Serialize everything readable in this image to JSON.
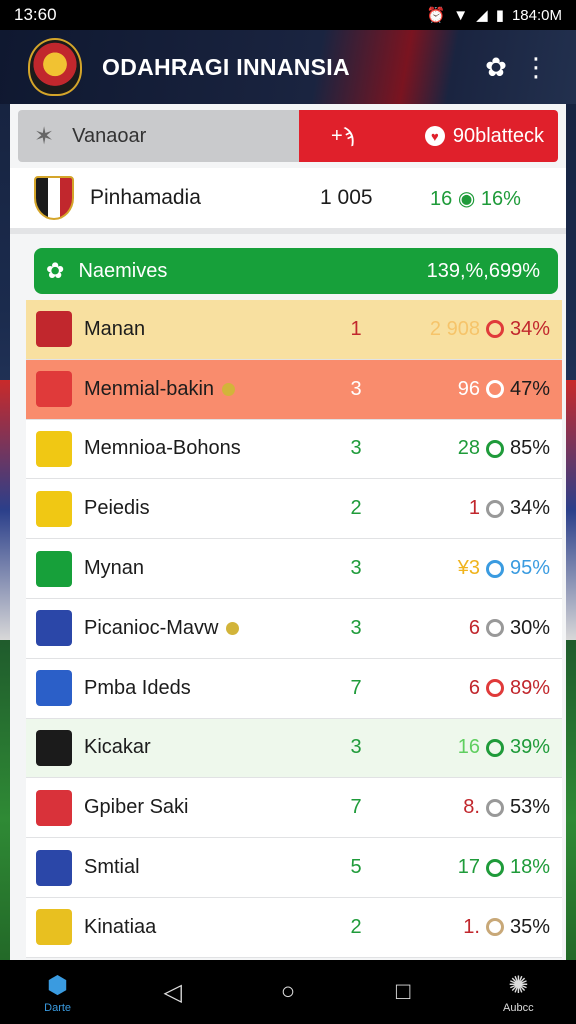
{
  "status_bar": {
    "time": "13:60",
    "right_time": "184:0M"
  },
  "header": {
    "title": "ODAHRAGI INNANSIA"
  },
  "tabs": {
    "left_label": "Vanaoar",
    "right_prefix": "+ϡ",
    "right_label": "90blatteck"
  },
  "leader": {
    "name": "Pinhamadia",
    "score": "1 005",
    "stat_num": "16",
    "stat_pct": "16%"
  },
  "banner": {
    "label": "Naemives",
    "value": "139,%,699%"
  },
  "rows": [
    {
      "team": "Manan",
      "pts": "1",
      "form_num": "2 908",
      "pct": "34%",
      "bg": "#f8e0a0",
      "pts_color": "#c1272d",
      "num_color": "#f6c46a",
      "g_color": "#e03a3a",
      "pct_color": "#c1272d",
      "badge": "#c1272d",
      "coin": false
    },
    {
      "team": "Menmial-bakin",
      "pts": "3",
      "form_num": "96",
      "pct": "47%",
      "bg": "#f98c6d",
      "pts_color": "#ffffff",
      "num_color": "#ffffff",
      "g_color": "#ffffff",
      "pct_color": "#1c1c1c",
      "badge": "#e03a3a",
      "coin": true
    },
    {
      "team": "Memnioa-Bohons",
      "pts": "3",
      "form_num": "28",
      "pct": "85%",
      "bg": "#ffffff",
      "pts_color": "#1f9b3a",
      "num_color": "#1f9b3a",
      "g_color": "#1f9b3a",
      "pct_color": "#1c1c1c",
      "badge": "#f0c814",
      "coin": false
    },
    {
      "team": "Peiedis",
      "pts": "2",
      "form_num": "1",
      "pct": "34%",
      "bg": "#ffffff",
      "pts_color": "#1f9b3a",
      "num_color": "#c1272d",
      "g_color": "#999999",
      "pct_color": "#1c1c1c",
      "badge": "#f0c814",
      "coin": false
    },
    {
      "team": "Mynan",
      "pts": "3",
      "form_num": "¥3",
      "pct": "95%",
      "bg": "#ffffff",
      "pts_color": "#1f9b3a",
      "num_color": "#f0b41e",
      "g_color": "#3a9be0",
      "pct_color": "#3a9be0",
      "badge": "#17a03a",
      "coin": false
    },
    {
      "team": "Picanioc-Mavw",
      "pts": "3",
      "form_num": "6",
      "pct": "30%",
      "bg": "#ffffff",
      "pts_color": "#1f9b3a",
      "num_color": "#c1272d",
      "g_color": "#999999",
      "pct_color": "#1c1c1c",
      "badge": "#2b47a8",
      "coin": true
    },
    {
      "team": "Pmba Ideds",
      "pts": "7",
      "form_num": "6",
      "pct": "89%",
      "bg": "#ffffff",
      "pts_color": "#1f9b3a",
      "num_color": "#c1272d",
      "g_color": "#e03a3a",
      "pct_color": "#c1272d",
      "badge": "#2b5fc8",
      "coin": false
    },
    {
      "team": "Kicakar",
      "pts": "3",
      "form_num": "16",
      "pct": "39%",
      "bg": "#eef8ec",
      "pts_color": "#1f9b3a",
      "num_color": "#5fcf5f",
      "g_color": "#1f9b3a",
      "pct_color": "#1f9b3a",
      "badge": "#1b1b1b",
      "coin": false
    },
    {
      "team": "Gpiber Saki",
      "pts": "7",
      "form_num": "8.",
      "pct": "53%",
      "bg": "#ffffff",
      "pts_color": "#1f9b3a",
      "num_color": "#c1272d",
      "g_color": "#999999",
      "pct_color": "#1c1c1c",
      "badge": "#d9323a",
      "coin": false
    },
    {
      "team": "Smtial",
      "pts": "5",
      "form_num": "17",
      "pct": "18%",
      "bg": "#ffffff",
      "pts_color": "#1f9b3a",
      "num_color": "#1f9b3a",
      "g_color": "#1f9b3a",
      "pct_color": "#1f9b3a",
      "badge": "#2b47a8",
      "coin": false
    },
    {
      "team": "Kinatiaa",
      "pts": "2",
      "form_num": "1.",
      "pct": "35%",
      "bg": "#ffffff",
      "pts_color": "#1f9b3a",
      "num_color": "#c1272d",
      "g_color": "#c8a878",
      "pct_color": "#1c1c1c",
      "badge": "#e8c020",
      "coin": false
    }
  ],
  "nav": {
    "left_label": "Darte",
    "right_label": "Aubcc"
  }
}
